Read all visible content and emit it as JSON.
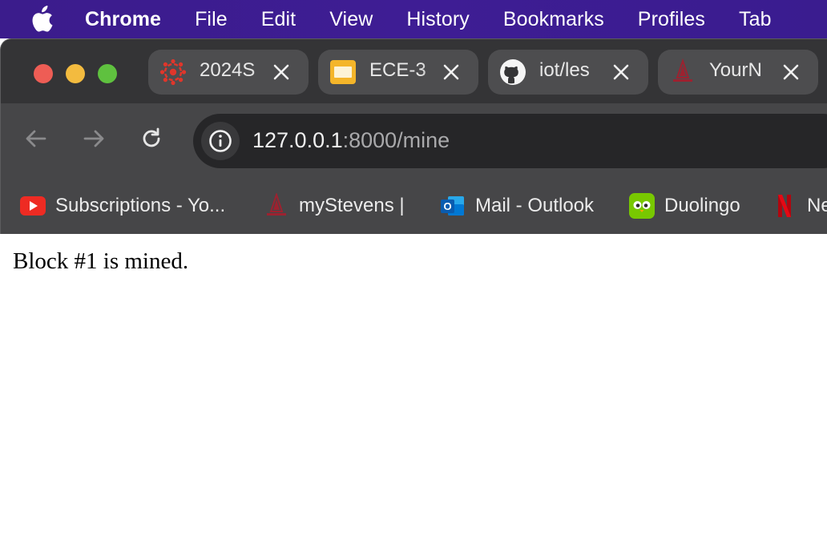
{
  "menubar": {
    "app_name": "Chrome",
    "items": [
      "File",
      "Edit",
      "View",
      "History",
      "Bookmarks",
      "Profiles",
      "Tab"
    ]
  },
  "tabs": [
    {
      "title": "2024S",
      "icon": "canvas-icon"
    },
    {
      "title": "ECE-3",
      "icon": "slides-icon"
    },
    {
      "title": "iot/les",
      "icon": "github-icon"
    },
    {
      "title": "YourN",
      "icon": "stevens-icon"
    }
  ],
  "address_bar": {
    "host": "127.0.0.1",
    "rest": ":8000/mine"
  },
  "bookmarks": [
    {
      "label": "Subscriptions - Yo...",
      "icon": "youtube-icon"
    },
    {
      "label": "myStevens |",
      "icon": "stevens-icon"
    },
    {
      "label": "Mail - Outlook",
      "icon": "outlook-icon"
    },
    {
      "label": "Duolingo",
      "icon": "duolingo-icon"
    },
    {
      "label": "Ne",
      "icon": "netflix-icon"
    }
  ],
  "page": {
    "body_text": "Block #1 is mined."
  },
  "colors": {
    "menubar_bg": "#3e1d94",
    "tab_bar_bg": "#343436",
    "toolbar_bg": "#464648",
    "omnibox_bg": "#262628"
  }
}
